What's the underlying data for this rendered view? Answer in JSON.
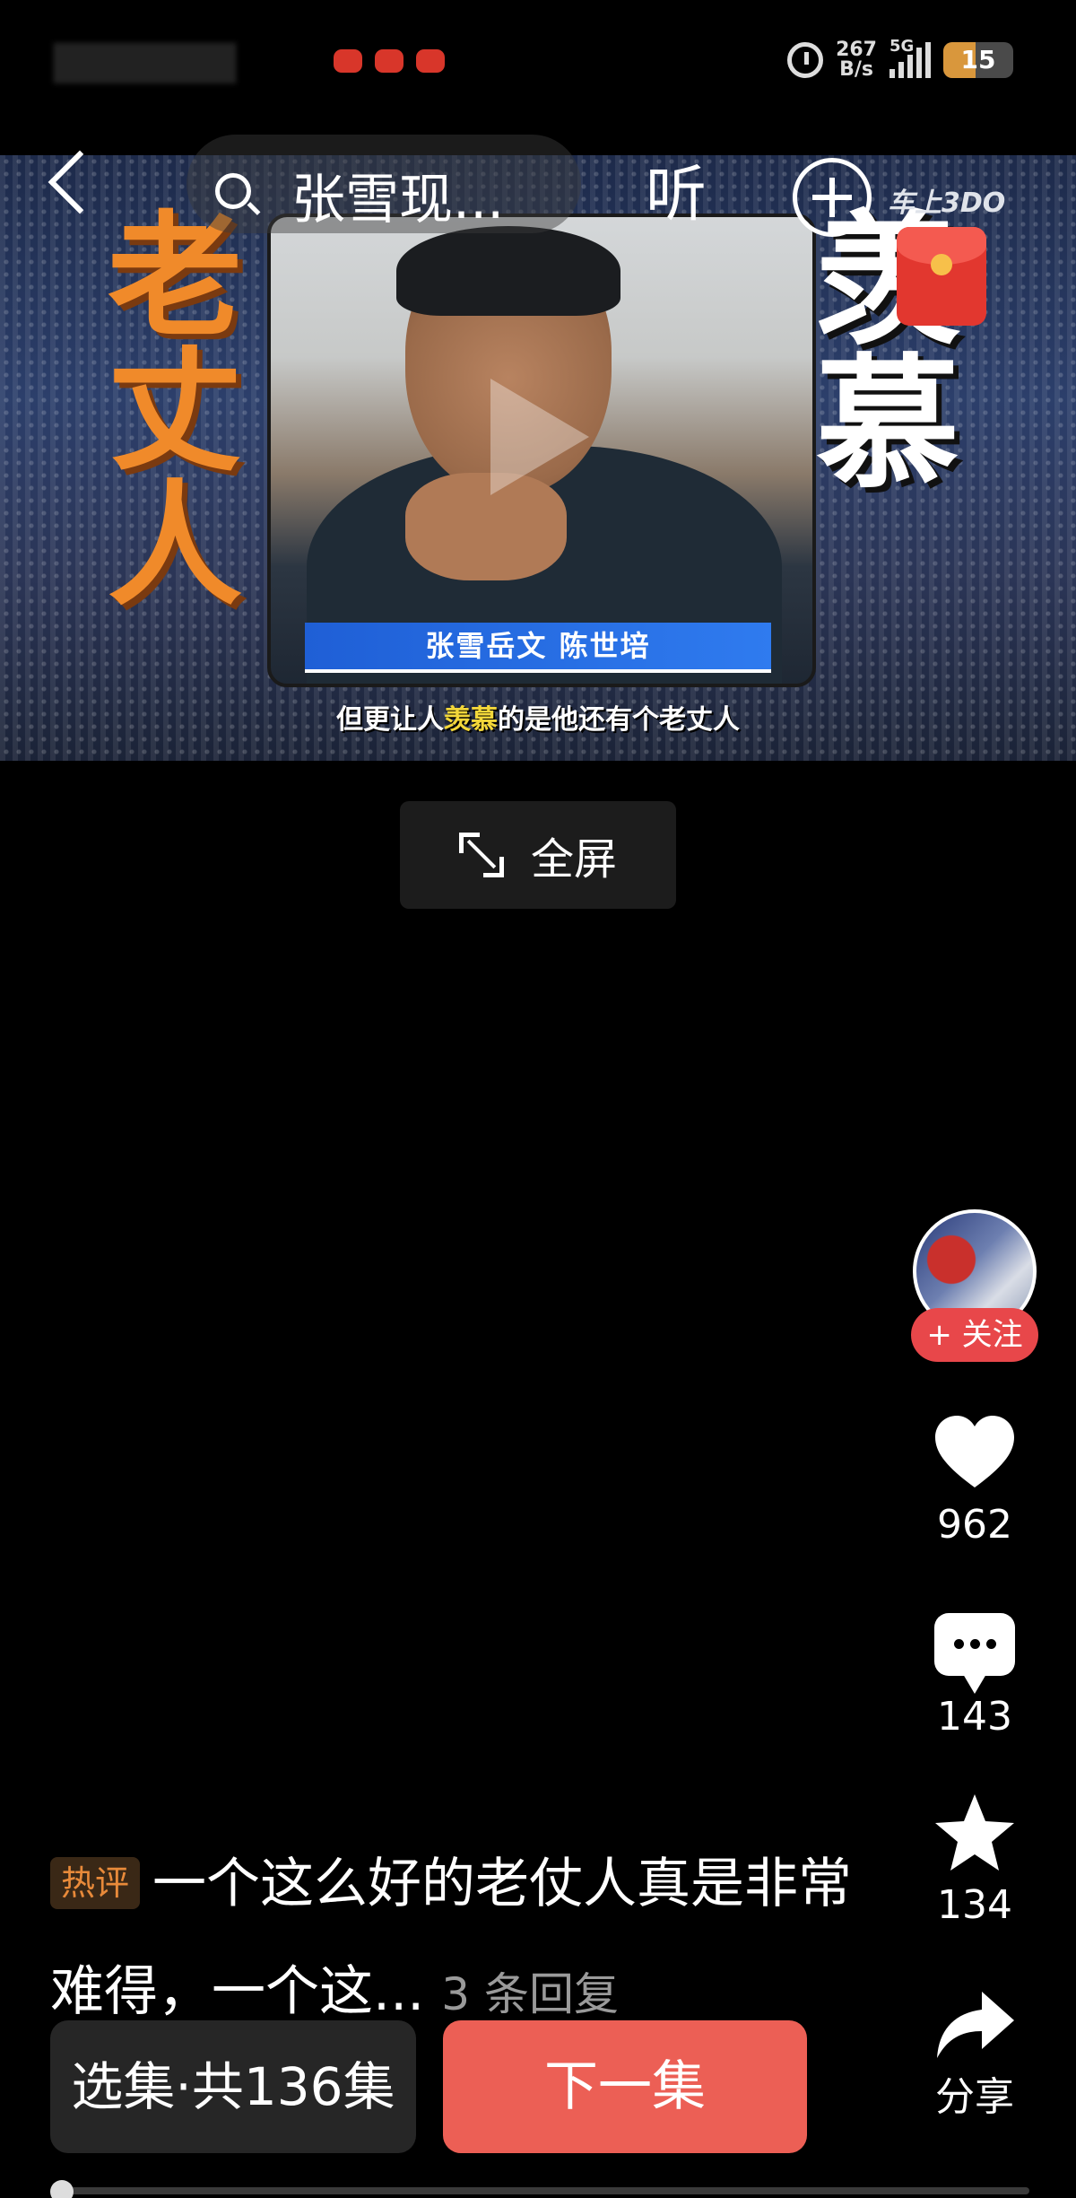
{
  "status_bar": {
    "net_speed_value": "267",
    "net_speed_unit": "B/s",
    "network_type": "5G",
    "battery_level": "15"
  },
  "top_bar": {
    "search_text": "张雪现...",
    "listen_label": "听"
  },
  "video": {
    "left_caption": [
      "老",
      "丈",
      "人"
    ],
    "right_caption": [
      "羡",
      "慕"
    ],
    "name_banner": "张雪岳文 陈世培",
    "subtitle_before": "但更让人",
    "subtitle_highlight": "羡慕",
    "subtitle_after": "的是他还有个老丈人",
    "brand": "车上3DO"
  },
  "fullscreen": {
    "label": "全屏"
  },
  "rail": {
    "follow_label": "+ 关注",
    "likes": "962",
    "comments": "143",
    "favorites": "134",
    "share_label": "分享"
  },
  "hot_comment": {
    "badge": "热评",
    "text": "一个这么好的老仗人真是非常难得，一个这...",
    "replies": "3 条回复"
  },
  "bottom": {
    "episodes_label": "选集·共136集",
    "next_label": "下一集"
  },
  "colors": {
    "accent_red": "#ec5f55",
    "follow_red": "#e8474a",
    "hot_badge_orange": "#e88a3a"
  }
}
